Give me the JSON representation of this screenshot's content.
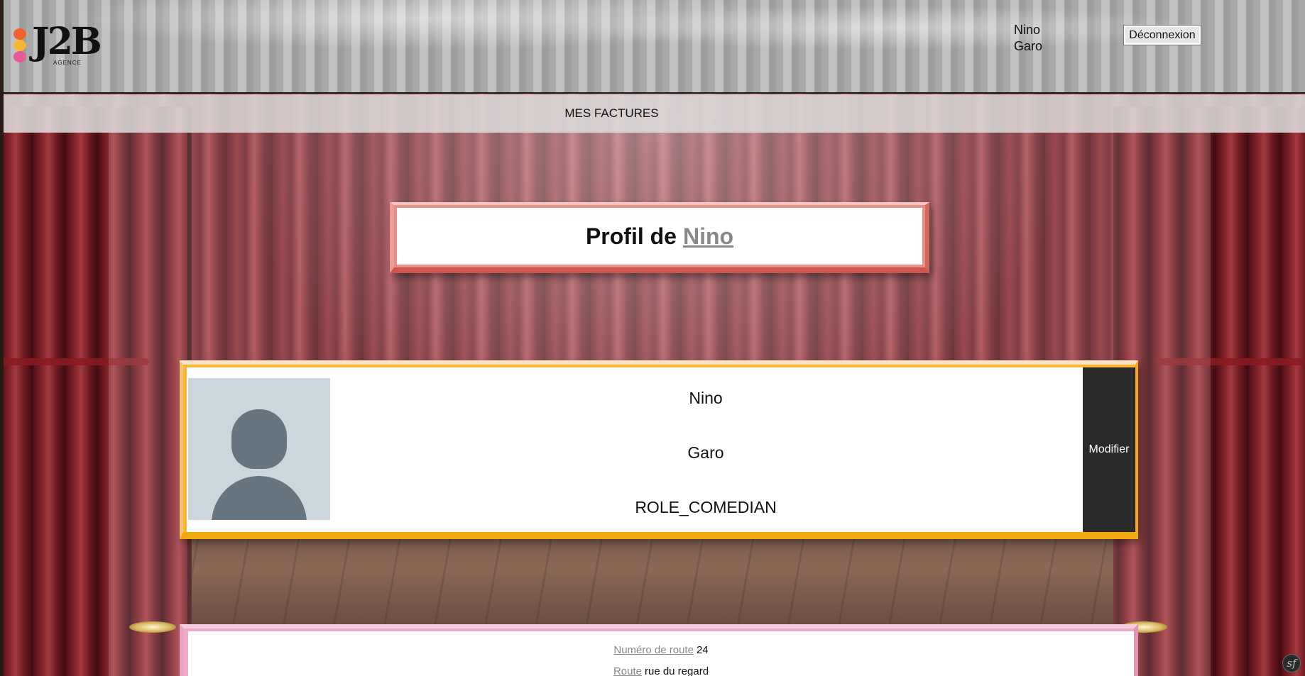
{
  "brand": {
    "logo_text": "J2B",
    "logo_sub": "AGENCE",
    "dot_colors": [
      "#f0622d",
      "#f5b731",
      "#e85a9a"
    ]
  },
  "header": {
    "first_name": "Nino",
    "last_name": "Garo",
    "logout_label": "Déconnexion"
  },
  "nav": {
    "items": [
      {
        "label": "MES FACTURES"
      }
    ]
  },
  "title": {
    "prefix": "Profil de",
    "name_link": "Nino"
  },
  "profile": {
    "first_name": "Nino",
    "last_name": "Garo",
    "role": "ROLE_COMEDIAN",
    "modify_label": "Modifier",
    "avatar_icon": "user-placeholder-icon"
  },
  "address": {
    "street_number_label": "Numéro de route",
    "street_number_value": "24",
    "street_label": "Route",
    "street_value": "rue du regard"
  },
  "debug": {
    "badge_icon": "symfony-icon",
    "badge_glyph": "sf"
  },
  "colors": {
    "title_border": "#d0564b",
    "profile_border": "#f0aa10",
    "address_border": "#f0a9c9",
    "modify_bg": "#2b2b2b"
  }
}
